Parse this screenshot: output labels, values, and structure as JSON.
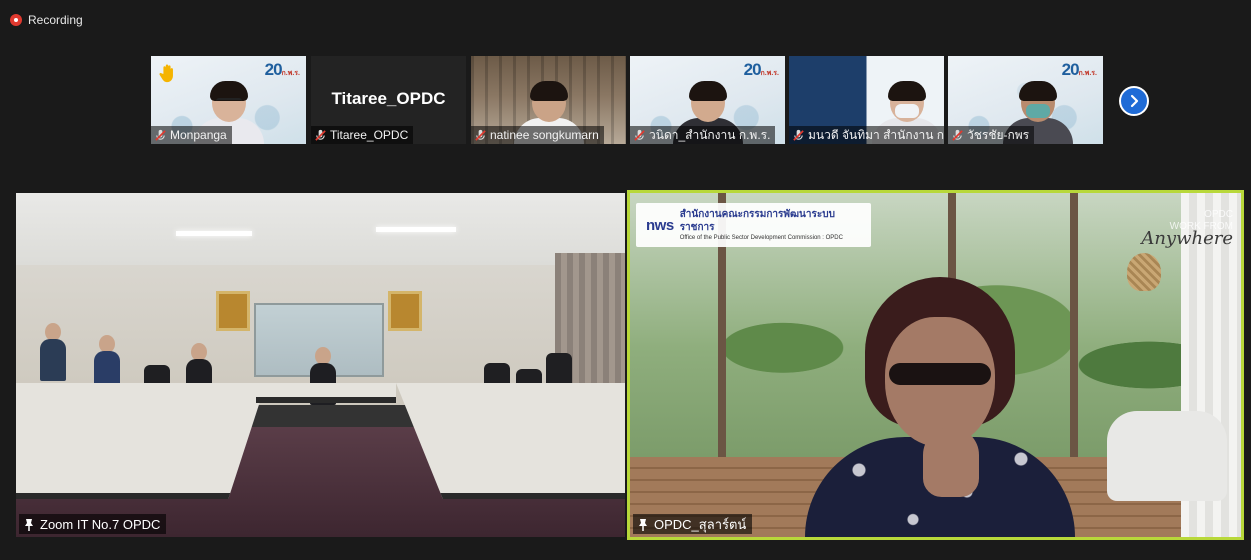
{
  "recording": {
    "label": "Recording"
  },
  "participants": [
    {
      "name": "Monpanga",
      "muted": true,
      "hand_raised": true,
      "bg": "light",
      "badge": "20"
    },
    {
      "name": "Titaree_OPDC",
      "muted": true,
      "video_off": true,
      "display_name": "Titaree_OPDC"
    },
    {
      "name": "natinee songkumarn",
      "muted": true,
      "bg": "library"
    },
    {
      "name": "วนิดา_สำนักงาน ก.พ.ร.",
      "muted": true,
      "bg": "light",
      "badge": "20"
    },
    {
      "name": "มนวดี จันทิมา สำนักงาน ก...",
      "muted": true,
      "bg": "blue"
    },
    {
      "name": "วัชรชัย-กพร",
      "muted": true,
      "bg": "light",
      "badge": "20"
    }
  ],
  "badge_sub": "ก.พ.ร.",
  "main_videos": {
    "left": {
      "name": "Zoom IT No.7 OPDC"
    },
    "right": {
      "name": "OPDC_สุลาร์ตน์",
      "active_speaker": true,
      "logo": {
        "mark": "nws",
        "thai": "สำนักงานคณะกรรมการพัฒนาระบบราชการ",
        "english": "Office of the Public Sector Development Commission : OPDC"
      },
      "watermark": {
        "line1": "OPDC",
        "line2": "WORK FROM",
        "script": "Anywhere"
      }
    }
  },
  "colors": {
    "active_border": "#b8d83a",
    "next_button": "#1f6bd6",
    "recording": "#e0392f"
  }
}
